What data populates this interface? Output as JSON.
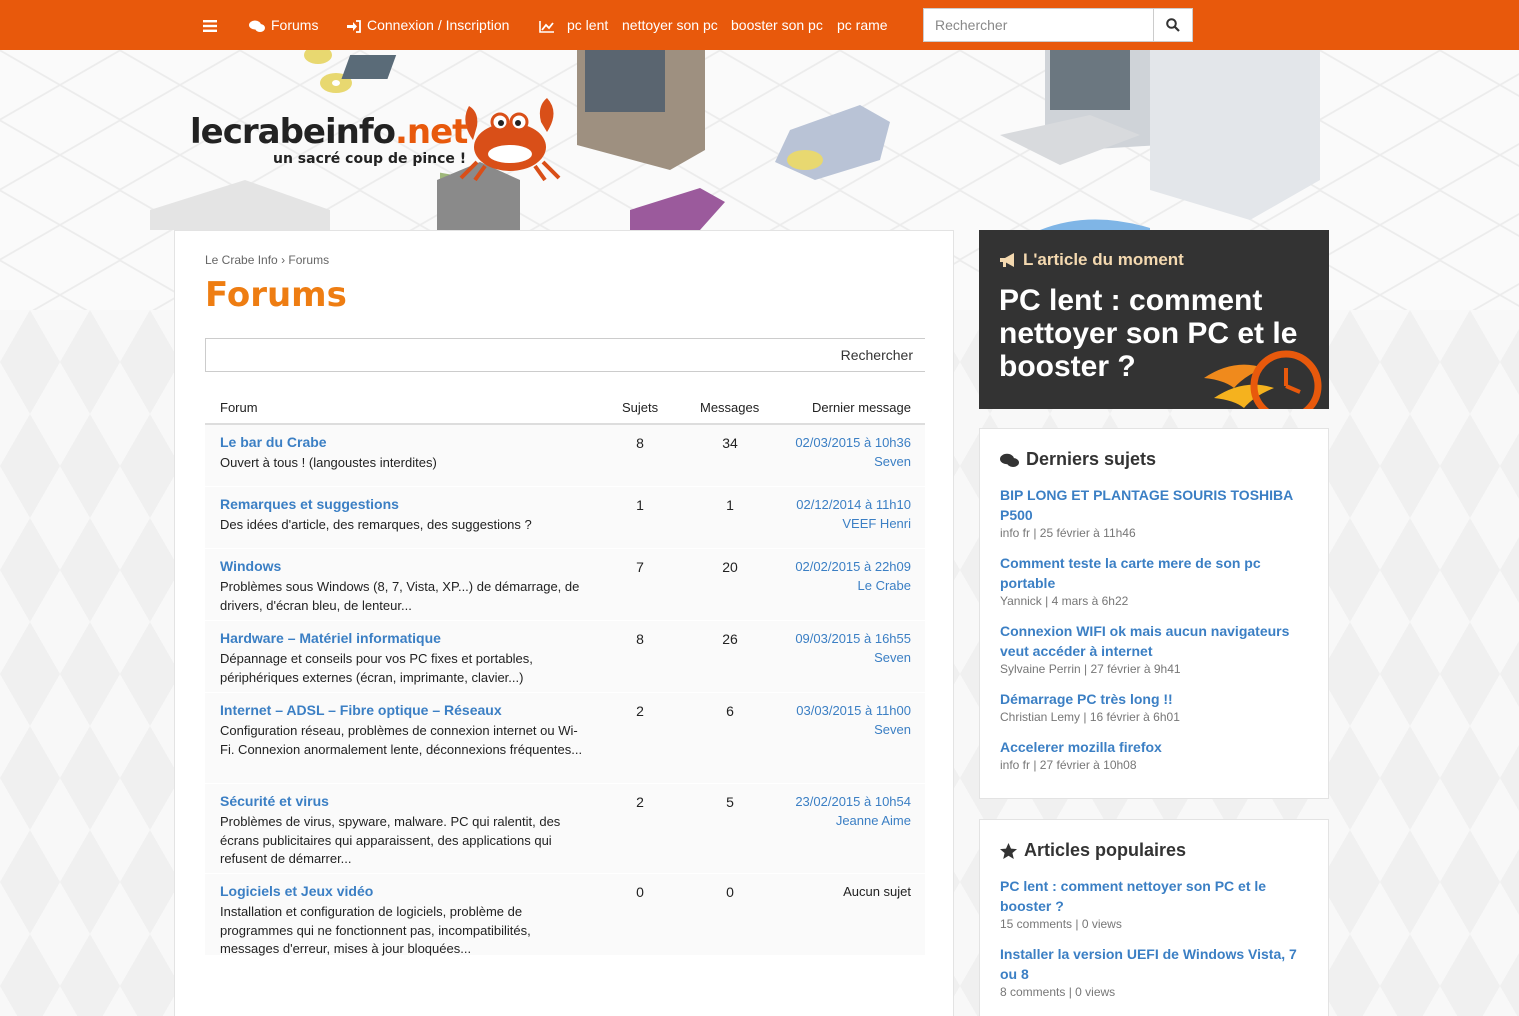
{
  "nav": {
    "forums": "Forums",
    "login": "Connexion / Inscription",
    "links": [
      "pc lent",
      "nettoyer son pc",
      "booster son pc",
      "pc rame"
    ],
    "search_placeholder": "Rechercher"
  },
  "header": {
    "logo_main": "lecrabeinfo",
    "logo_tld": ".net",
    "tagline": "un sacré coup de pince !"
  },
  "breadcrumb": [
    "Le Crabe Info",
    "›",
    "Forums"
  ],
  "page_title": "Forums",
  "forum_search_button": "Rechercher",
  "table": {
    "headers": [
      "Forum",
      "Sujets",
      "Messages",
      "Dernier message"
    ],
    "rows": [
      {
        "name": "Le bar du Crabe",
        "desc": "Ouvert à tous ! (langoustes interdites)",
        "topics": "8",
        "posts": "34",
        "date": "02/03/2015 à 10h36",
        "author": "Seven"
      },
      {
        "name": "Remarques et suggestions",
        "desc": "Des idées d'article, des remarques, des suggestions ?",
        "topics": "1",
        "posts": "1",
        "date": "02/12/2014 à 11h10",
        "author": "VEEF Henri"
      },
      {
        "name": "Windows",
        "desc": "Problèmes sous Windows (8, 7, Vista, XP...) de démarrage, de drivers, d'écran bleu, de lenteur...",
        "topics": "7",
        "posts": "20",
        "date": "02/02/2015 à 22h09",
        "author": "Le Crabe"
      },
      {
        "name": "Hardware – Matériel informatique",
        "desc": "Dépannage et conseils pour vos PC fixes et portables, périphériques externes (écran, imprimante, clavier...)",
        "topics": "8",
        "posts": "26",
        "date": "09/03/2015 à 16h55",
        "author": "Seven"
      },
      {
        "name": "Internet – ADSL – Fibre optique – Réseaux",
        "desc": "Configuration réseau, problèmes de connexion internet ou Wi-Fi. Connexion anormalement lente, déconnexions fréquentes...",
        "topics": "2",
        "posts": "6",
        "date": "03/03/2015 à 11h00",
        "author": "Seven"
      },
      {
        "name": "Sécurité et virus",
        "desc": "Problèmes de virus, spyware, malware. PC qui ralentit, des écrans publicitaires qui apparaissent, des applications qui refusent de démarrer...",
        "topics": "2",
        "posts": "5",
        "date": "23/02/2015 à 10h54",
        "author": "Jeanne Aime"
      },
      {
        "name": "Logiciels et Jeux vidéo",
        "desc": "Installation et configuration de logiciels, problème de programmes qui ne fonctionnent pas, incompatibilités, messages d'erreur, mises à jour bloquées...",
        "topics": "0",
        "posts": "0",
        "date": "",
        "author": "",
        "none": "Aucun sujet"
      }
    ]
  },
  "article_box": {
    "label": "L'article du moment",
    "title": "PC lent : comment nettoyer son PC et le booster ?"
  },
  "latest": {
    "title": "Derniers sujets",
    "items": [
      {
        "title": "BIP LONG ET PLANTAGE SOURIS TOSHIBA P500",
        "meta": "info fr | 25 février à 11h46"
      },
      {
        "title": "Comment teste la carte mere de son pc portable",
        "meta": "Yannick | 4 mars à 6h22"
      },
      {
        "title": "Connexion WIFI ok mais aucun navigateurs veut accéder à internet",
        "meta": "Sylvaine Perrin | 27 février à 9h41"
      },
      {
        "title": "Démarrage PC très long !!",
        "meta": "Christian Lemy | 16 février à 6h01"
      },
      {
        "title": "Accelerer mozilla firefox",
        "meta": "info fr | 27 février à 10h08"
      }
    ]
  },
  "popular": {
    "title": "Articles populaires",
    "items": [
      {
        "title": "PC lent : comment nettoyer son PC et le booster ?",
        "meta": "15 comments | 0 views"
      },
      {
        "title": "Installer la version UEFI de Windows Vista, 7 ou 8",
        "meta": "8 comments | 0 views"
      }
    ]
  },
  "colors": {
    "brand": "#e8590c",
    "title": "#ee7d12",
    "link": "#3b7fc4"
  }
}
